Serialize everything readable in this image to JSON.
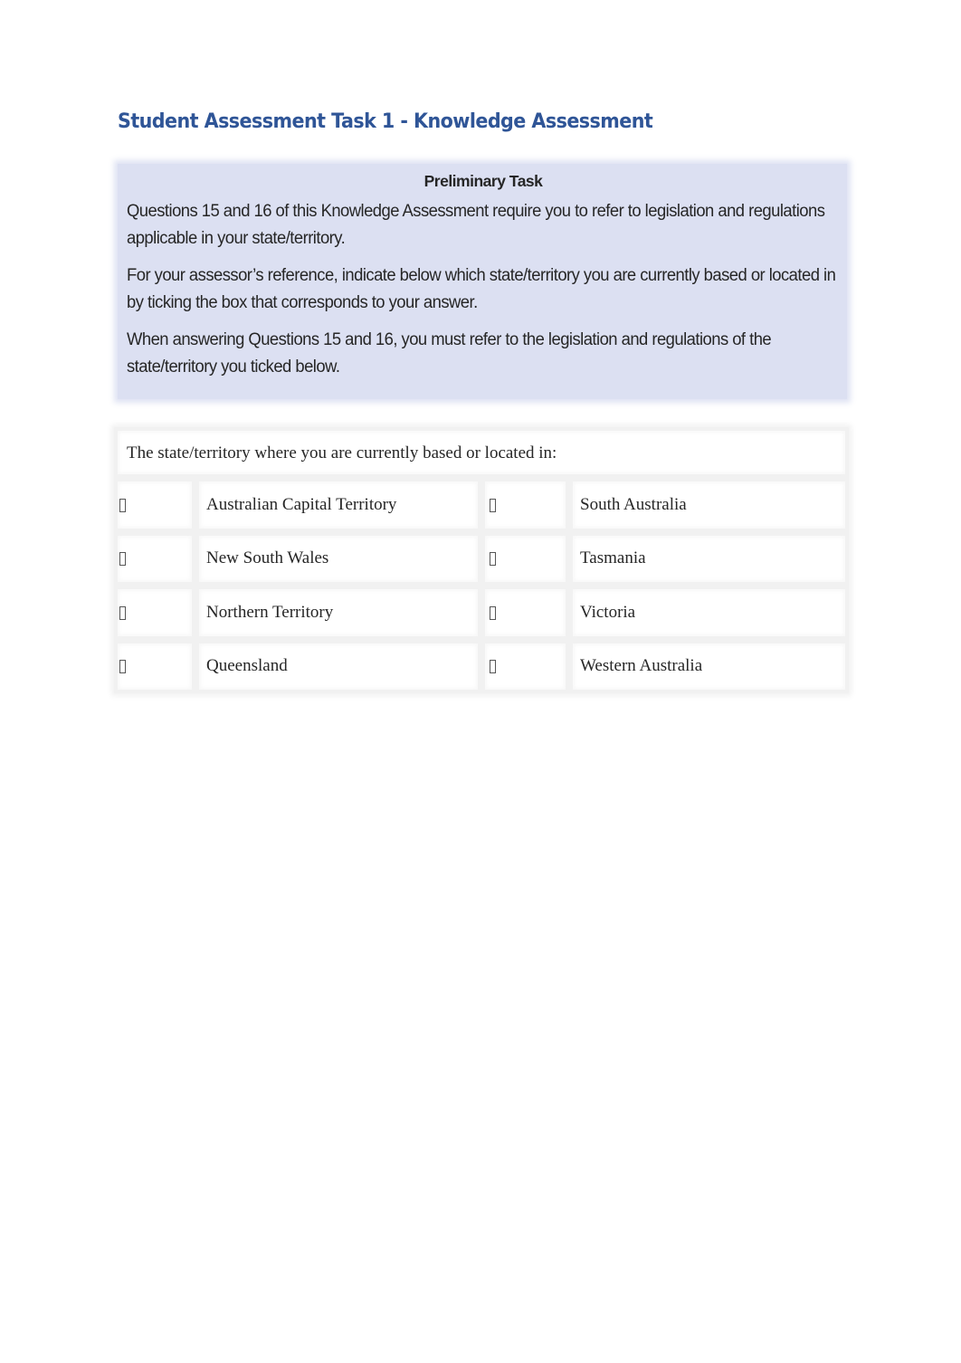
{
  "document": {
    "title": "Student Assessment Task 1 - Knowledge Assessment",
    "preliminary_task": {
      "heading": "Preliminary Task",
      "paragraphs": [
        "Questions 15 and 16 of this Knowledge Assessment require you to refer to legislation and regulations applicable in your state/territory.",
        "For your assessor’s reference, indicate below which state/territory you are currently based or located in by ticking the box that corresponds to your answer.",
        "When answering Questions 15 and 16, you must refer to the legislation and regulations of the state/territory you ticked below."
      ]
    },
    "state_selection": {
      "prompt": "The state/territory where you are currently based or located in:",
      "checkbox_icon": "checkbox-icon (unticked, rendered as missing-glyph box)",
      "rows": [
        {
          "left": {
            "label": "Australian Capital Territory",
            "checked": false
          },
          "right": {
            "label": "South Australia",
            "checked": false
          }
        },
        {
          "left": {
            "label": "New South Wales",
            "checked": false
          },
          "right": {
            "label": "Tasmania",
            "checked": false
          }
        },
        {
          "left": {
            "label": "Northern Territory",
            "checked": false
          },
          "right": {
            "label": "Victoria",
            "checked": false
          }
        },
        {
          "left": {
            "label": "Queensland",
            "checked": false
          },
          "right": {
            "label": "Western Australia",
            "checked": false
          }
        }
      ]
    }
  },
  "colors": {
    "title": "#2f5597",
    "preliminary_background": "#dce0f2",
    "body_text": "#262626",
    "table_border": "#f1f1f1"
  }
}
